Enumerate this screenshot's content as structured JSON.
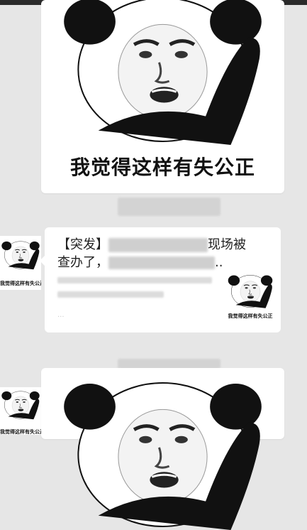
{
  "meme": {
    "caption": "我觉得这样有失公正",
    "image_name": "panda-face-meme"
  },
  "timestamps": [
    "",
    ""
  ],
  "link_card": {
    "title_prefix": "【突发】",
    "title_suffix_1": "现场被",
    "title_line2_prefix": "查办了，",
    "title_ellipsis": "..",
    "thumb_caption": "我觉得这样有失公正",
    "desc_extra": "..."
  },
  "avatar": {
    "caption": "我觉得这样有失公正"
  },
  "colors": {
    "background": "#e6e6e6",
    "card": "#ffffff",
    "topbar": "#2b2b2b"
  }
}
